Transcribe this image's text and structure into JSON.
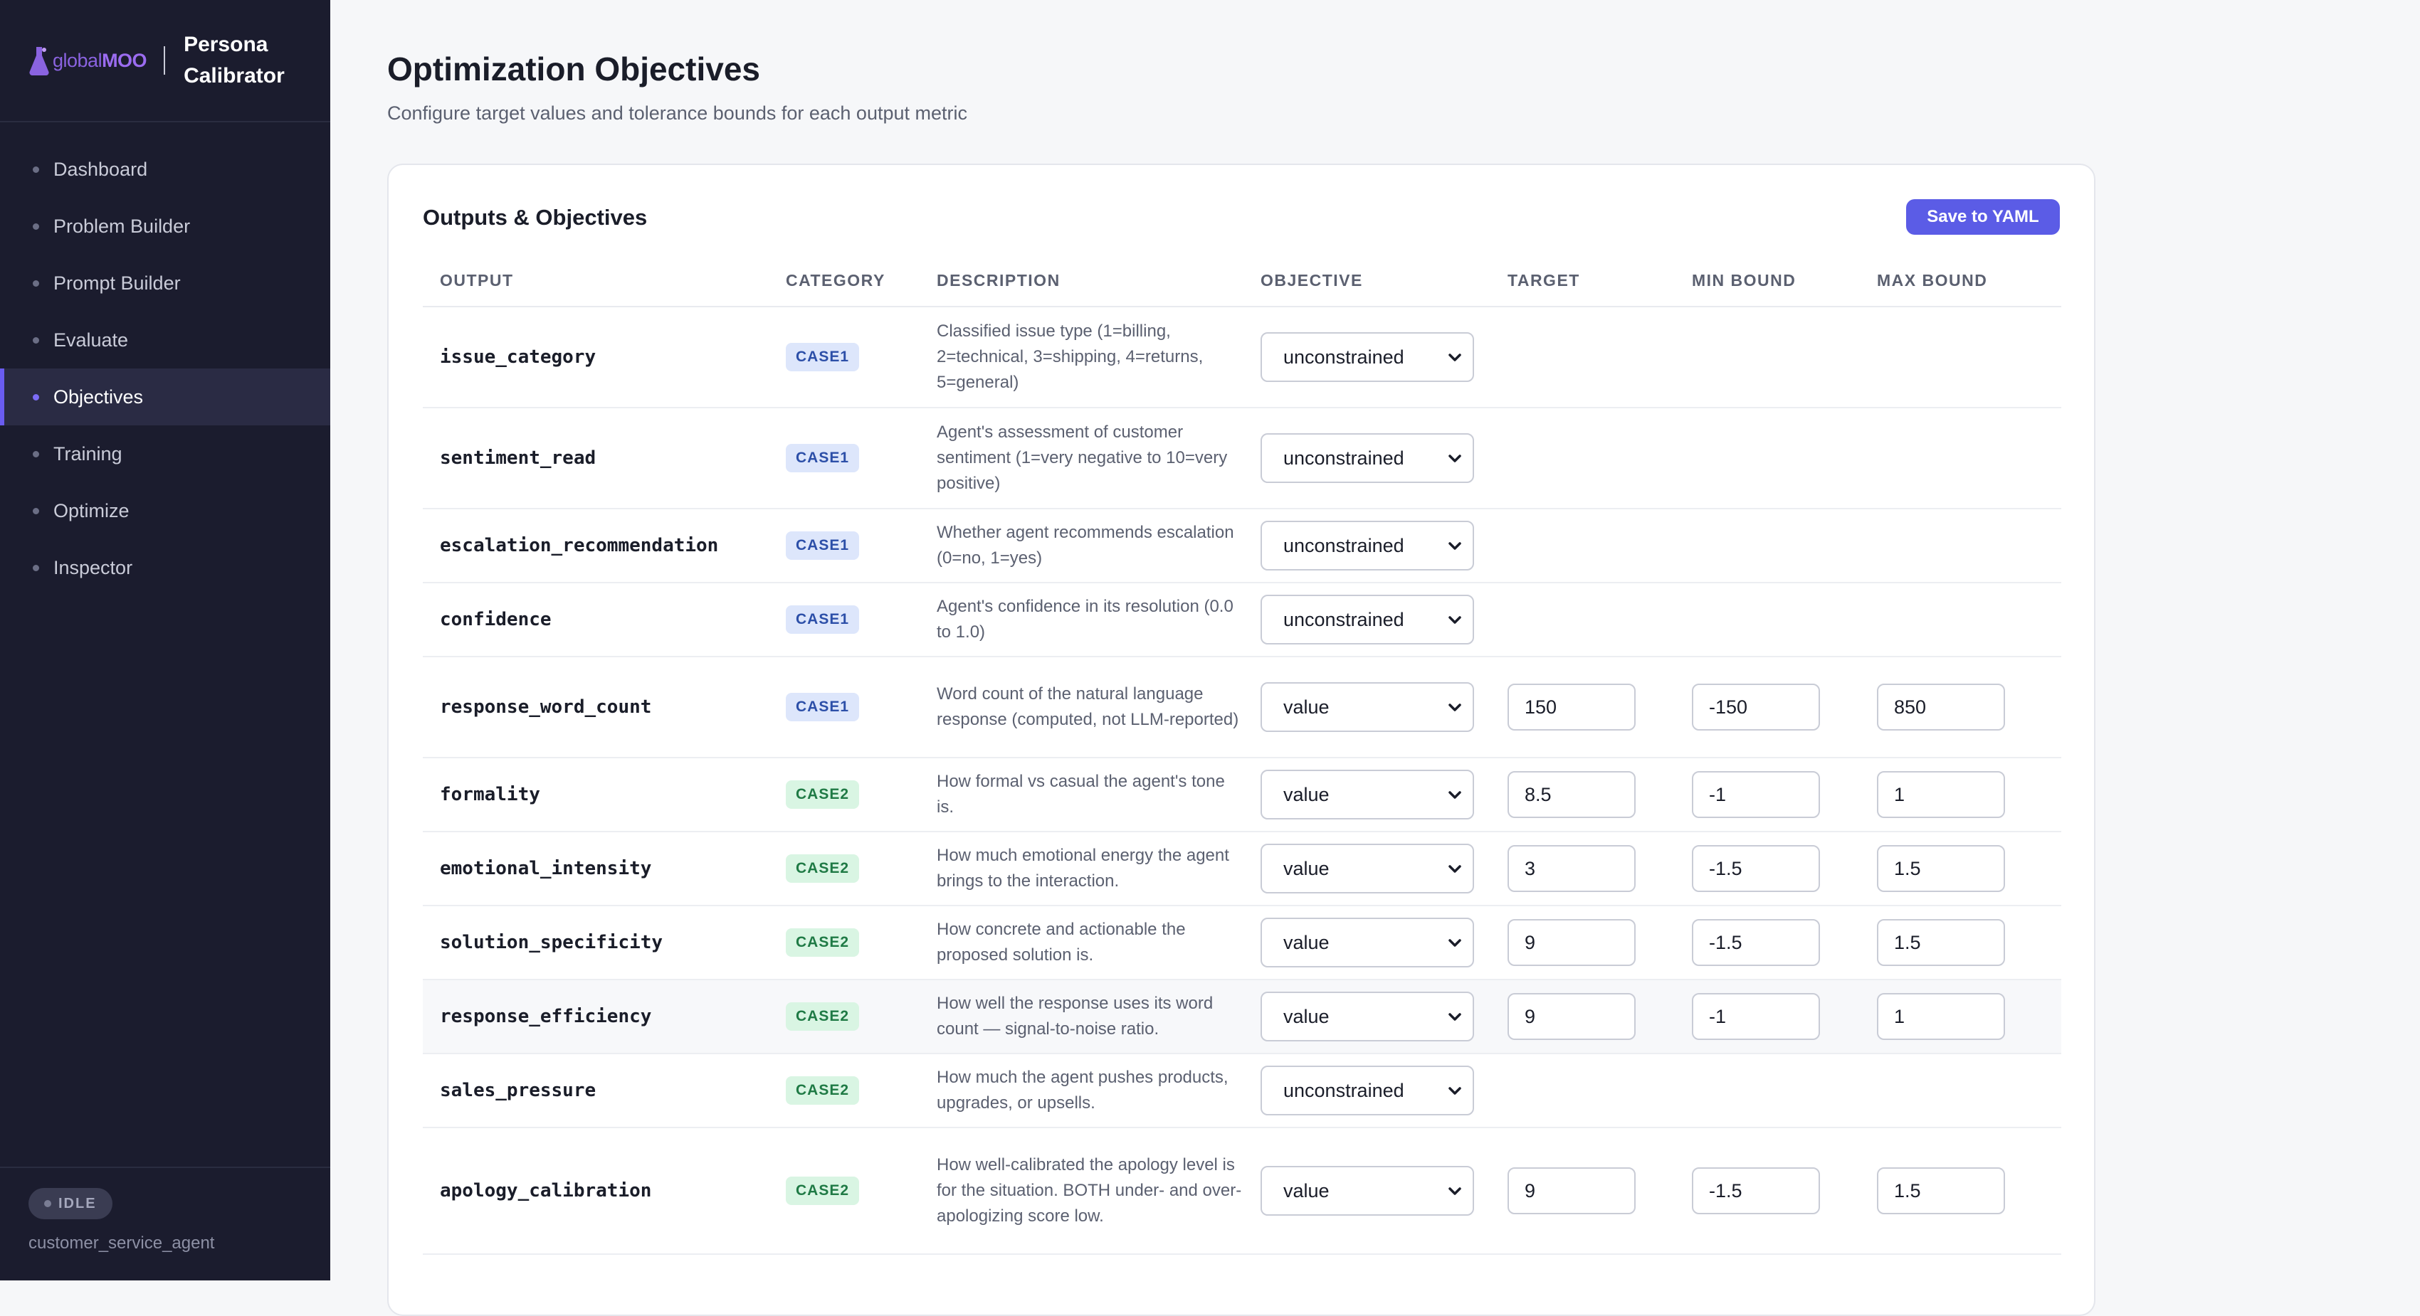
{
  "app": {
    "logo_text_a": "global",
    "logo_text_b": "MOO",
    "title_line1": "Persona",
    "title_line2": "Calibrator"
  },
  "sidebar": {
    "items": [
      {
        "label": "Dashboard"
      },
      {
        "label": "Problem Builder"
      },
      {
        "label": "Prompt Builder"
      },
      {
        "label": "Evaluate"
      },
      {
        "label": "Objectives"
      },
      {
        "label": "Training"
      },
      {
        "label": "Optimize"
      },
      {
        "label": "Inspector"
      }
    ],
    "active_index": 4,
    "status": "IDLE",
    "workspace": "customer_service_agent"
  },
  "page": {
    "title": "Optimization Objectives",
    "subtitle": "Configure target values and tolerance bounds for each output metric"
  },
  "card": {
    "title": "Outputs & Objectives",
    "save_label": "Save to YAML"
  },
  "table": {
    "headers": {
      "output": "OUTPUT",
      "category": "CATEGORY",
      "description": "DESCRIPTION",
      "objective": "OBJECTIVE",
      "target": "TARGET",
      "min_bound": "MIN BOUND",
      "max_bound": "MAX BOUND"
    },
    "rows": [
      {
        "output": "issue_category",
        "category": "CASE1",
        "description": "Classified issue type (1=billing, 2=technical, 3=shipping, 4=returns, 5=general)",
        "objective": "unconstrained",
        "target": "",
        "min": "",
        "max": ""
      },
      {
        "output": "sentiment_read",
        "category": "CASE1",
        "description": "Agent's assessment of customer sentiment (1=very negative to 10=very positive)",
        "objective": "unconstrained",
        "target": "",
        "min": "",
        "max": ""
      },
      {
        "output": "escalation_recommendation",
        "category": "CASE1",
        "description": "Whether agent recommends escalation (0=no, 1=yes)",
        "objective": "unconstrained",
        "target": "",
        "min": "",
        "max": ""
      },
      {
        "output": "confidence",
        "category": "CASE1",
        "description": "Agent's confidence in its resolution (0.0 to 1.0)",
        "objective": "unconstrained",
        "target": "",
        "min": "",
        "max": ""
      },
      {
        "output": "response_word_count",
        "category": "CASE1",
        "description": "Word count of the natural language response (computed, not LLM-reported)",
        "objective": "value",
        "target": "150",
        "min": "-150",
        "max": "850"
      },
      {
        "output": "formality",
        "category": "CASE2",
        "description": "How formal vs casual the agent's tone is.",
        "objective": "value",
        "target": "8.5",
        "min": "-1",
        "max": "1"
      },
      {
        "output": "emotional_intensity",
        "category": "CASE2",
        "description": "How much emotional energy the agent brings to the interaction.",
        "objective": "value",
        "target": "3",
        "min": "-1.5",
        "max": "1.5"
      },
      {
        "output": "solution_specificity",
        "category": "CASE2",
        "description": "How concrete and actionable the proposed solution is.",
        "objective": "value",
        "target": "9",
        "min": "-1.5",
        "max": "1.5"
      },
      {
        "output": "response_efficiency",
        "category": "CASE2",
        "description": "How well the response uses its word count — signal-to-noise ratio.",
        "objective": "value",
        "target": "9",
        "min": "-1",
        "max": "1"
      },
      {
        "output": "sales_pressure",
        "category": "CASE2",
        "description": "How much the agent pushes products, upgrades, or upsells.",
        "objective": "unconstrained",
        "target": "",
        "min": "",
        "max": ""
      },
      {
        "output": "apology_calibration",
        "category": "CASE2",
        "description": "How well-calibrated the apology level is for the situation. BOTH under- and over-apologizing score low.",
        "objective": "value",
        "target": "9",
        "min": "-1.5",
        "max": "1.5"
      }
    ]
  },
  "colors": {
    "accent": "#5b5ce6",
    "sidebar_bg": "#1b1c2e",
    "case1_bg": "#dde6fb",
    "case2_bg": "#d9f5e3"
  }
}
